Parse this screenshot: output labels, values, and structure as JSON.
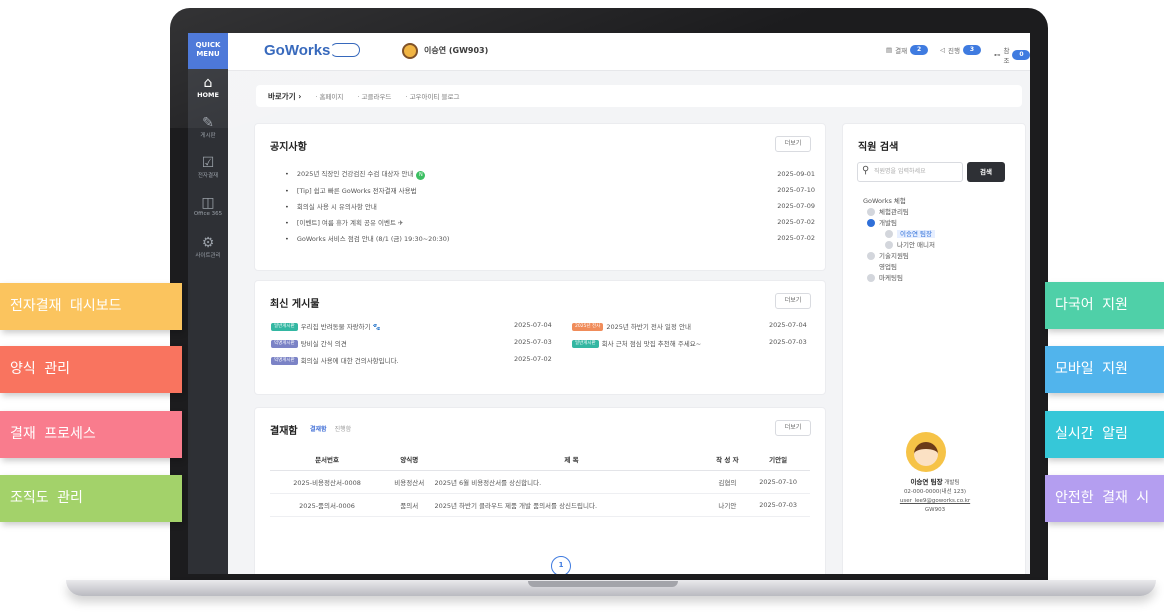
{
  "quick_menu": {
    "title": "QUICK MENU",
    "items": [
      {
        "label": "HOME",
        "icon": "home-icon",
        "glyph": "⌂"
      },
      {
        "label": "게시판",
        "icon": "pencil-icon",
        "glyph": "✎"
      },
      {
        "label": "전자결재",
        "icon": "document-check-icon",
        "glyph": "☑"
      },
      {
        "label": "Office 365",
        "icon": "office-icon",
        "glyph": "◫"
      },
      {
        "label": "사이트관리",
        "icon": "gear-icon",
        "glyph": "⚙"
      }
    ]
  },
  "header": {
    "logo": "GoWorks",
    "user": "이승연 (GW903)",
    "stats": [
      {
        "label": "결재",
        "count": "2",
        "icon": "approval-icon"
      },
      {
        "label": "진행",
        "count": "3",
        "icon": "progress-icon"
      },
      {
        "label": "참조",
        "count": "0",
        "icon": "reference-icon"
      }
    ]
  },
  "breadcrumb": {
    "label": "바로가기",
    "links": [
      "홈페이지",
      "고클라우드",
      "고우아이티 블로그"
    ]
  },
  "notices": {
    "title": "공지사항",
    "more": "더보기",
    "items": [
      {
        "title": "2025년 직장인 건강검진 수검 대상자 안내",
        "badge": "N",
        "date": "2025-09-01"
      },
      {
        "title": "[Tip] 쉽고 빠른 GoWorks 전자결재 사용법",
        "date": "2025-07-10"
      },
      {
        "title": "회의실 사용 시 유의사항 안내",
        "date": "2025-07-09"
      },
      {
        "title": "[이벤트] 여름 휴가 계획 공유 이벤트 ✈",
        "date": "2025-07-02"
      },
      {
        "title": "GoWorks 서비스 점검 안내 (8/1 (금) 19:30~20:30)",
        "date": "2025-07-02"
      }
    ]
  },
  "posts": {
    "title": "최신 게시물",
    "more": "더보기",
    "left": [
      {
        "tag": "일반게시판",
        "tag_color": "green",
        "title": "우리집 반려동물 자랑하기 🐾",
        "date": "2025-07-04"
      },
      {
        "tag": "익명게시판",
        "tag_color": "purple",
        "title": "탕비실 간식 의견",
        "date": "2025-07-03"
      },
      {
        "tag": "익명게시판",
        "tag_color": "purple",
        "title": "회의실 사용에 대한 건의사항입니다.",
        "date": "2025-07-02"
      }
    ],
    "right": [
      {
        "tag": "2025년 전사",
        "tag_color": "orange",
        "title": "2025년 하반기 전사 일정 안내",
        "date": "2025-07-04"
      },
      {
        "tag": "일반게시판",
        "tag_color": "green",
        "title": "회사 근처 점심 맛집 추천해 주세요~",
        "date": "2025-07-03"
      }
    ]
  },
  "approvals": {
    "title": "결재함",
    "tabs": [
      "결재함",
      "진행함"
    ],
    "more": "더보기",
    "columns": [
      "문서번호",
      "양식명",
      "제 목",
      "작 성 자",
      "기안일"
    ],
    "rows": [
      [
        "2025-비용정산서-0008",
        "비용정산서",
        "2025년 6월 비용정산서를 상신합니다.",
        "김협의",
        "2025-07-10"
      ],
      [
        "2025-품의서-0006",
        "품의서",
        "2025년 하반기 클라우드 제품 개발 품의서를 상신드립니다.",
        "나기안",
        "2025-07-03"
      ]
    ],
    "page": "1"
  },
  "employee_search": {
    "title": "직원 검색",
    "placeholder": "직원명을 입력하세요",
    "button": "검색",
    "root": "GoWorks 체험",
    "tree": [
      {
        "label": "체험관리팀",
        "level": 1,
        "dot": "grey"
      },
      {
        "label": "개발팀",
        "level": 1,
        "dot": "blue"
      },
      {
        "label": "이승연 팀장",
        "level": 2,
        "dot": "grey",
        "selected": true
      },
      {
        "label": "나기안 매니저",
        "level": 2,
        "dot": "grey"
      },
      {
        "label": "기술지원팀",
        "level": 1,
        "dot": "grey"
      },
      {
        "label": "영업팀",
        "level": 1,
        "dot": "none"
      },
      {
        "label": "마케팅팀",
        "level": 1,
        "dot": "grey"
      }
    ],
    "profile": {
      "name": "이승연 팀장",
      "team": "개발팀",
      "phone": "02-000-0000(내선 123)",
      "email": "user_lee9@goworks.co.kr",
      "id": "GW903"
    }
  },
  "feature_labels": {
    "left": [
      {
        "text": "전자결재 대시보드",
        "color": "#fbc45e"
      },
      {
        "text": "양식 관리",
        "color": "#f9745f"
      },
      {
        "text": "결재 프로세스",
        "color": "#f97c8d"
      },
      {
        "text": "조직도 관리",
        "color": "#a3d26a"
      }
    ],
    "right": [
      {
        "text": "다국어 지원",
        "color": "#4fd0a8"
      },
      {
        "text": "모바일 지원",
        "color": "#51b4ec"
      },
      {
        "text": "실시간 알림",
        "color": "#36c7d8"
      },
      {
        "text": "안전한 결재 시",
        "color": "#b49ef0"
      }
    ]
  }
}
